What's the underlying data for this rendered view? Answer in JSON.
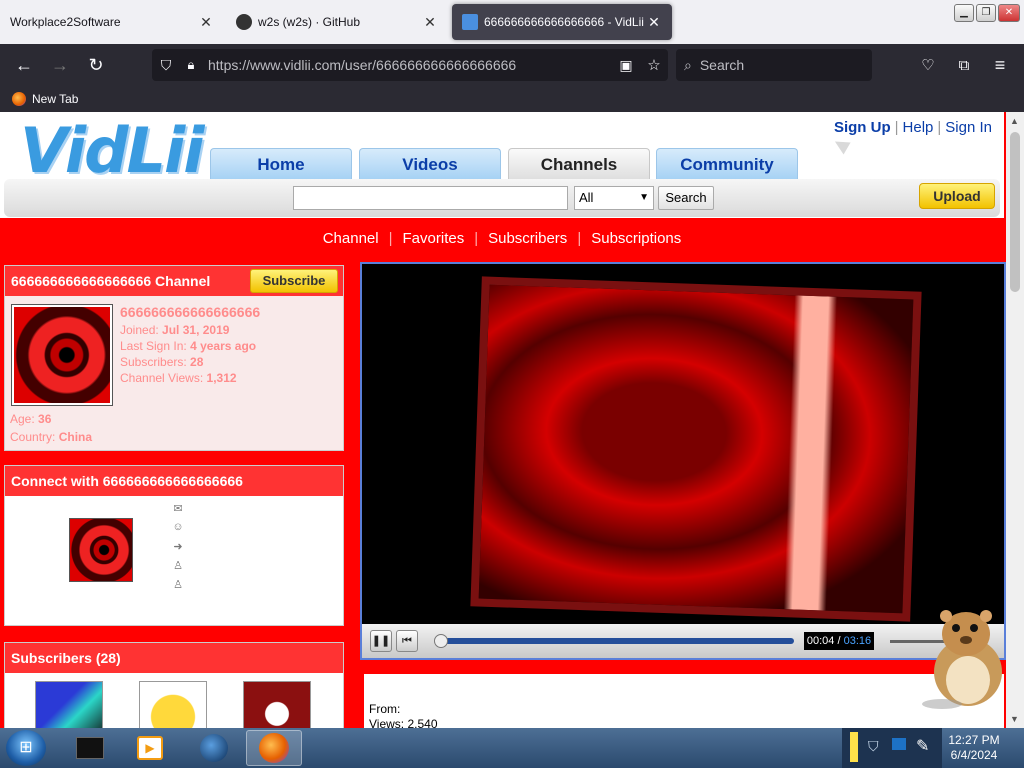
{
  "browser": {
    "tabs": [
      {
        "title": "Workplace2Software"
      },
      {
        "title": "w2s (w2s) · GitHub"
      },
      {
        "title": "666666666666666666 - VidLii"
      }
    ],
    "url": "https://www.vidlii.com/user/666666666666666666",
    "search_placeholder": "Search",
    "bookmark": "New Tab"
  },
  "site": {
    "logo": "VidLii",
    "top_links": {
      "signup": "Sign Up",
      "help": "Help",
      "signin": "Sign In"
    },
    "nav_tabs": [
      "Home",
      "Videos",
      "Channels",
      "Community"
    ],
    "search": {
      "category": "All",
      "button": "Search"
    },
    "upload": "Upload"
  },
  "channel_nav": [
    "Channel",
    "Favorites",
    "Subscribers",
    "Subscriptions"
  ],
  "profile": {
    "header": "666666666666666666 Channel",
    "subscribe": "Subscribe",
    "username": "666666666666666666",
    "joined_label": "Joined:",
    "joined": "Jul 31, 2019",
    "signin_label": "Last Sign In:",
    "last_signin": "4 years ago",
    "subs_label": "Subscribers:",
    "subscribers": "28",
    "views_label": "Channel Views:",
    "channel_views": "1,312",
    "age_label": "Age:",
    "age": "36",
    "country_label": "Country:",
    "country": "China"
  },
  "connect": {
    "header": "Connect with 666666666666666666"
  },
  "subscribers_box": {
    "header": "Subscribers (28)"
  },
  "player": {
    "current_time": "00:04",
    "sep": " / ",
    "duration": "03:16"
  },
  "video_details": {
    "from_label": "From:",
    "views_line": "Views: 2,540"
  },
  "taskbar": {
    "time": "12:27 PM",
    "date": "6/4/2024"
  },
  "colors": {
    "page_bg": "#ff0000",
    "accent_blue": "#0b3ea8",
    "box_header": "#ff3333",
    "upload_yellow": "#f2c200"
  }
}
